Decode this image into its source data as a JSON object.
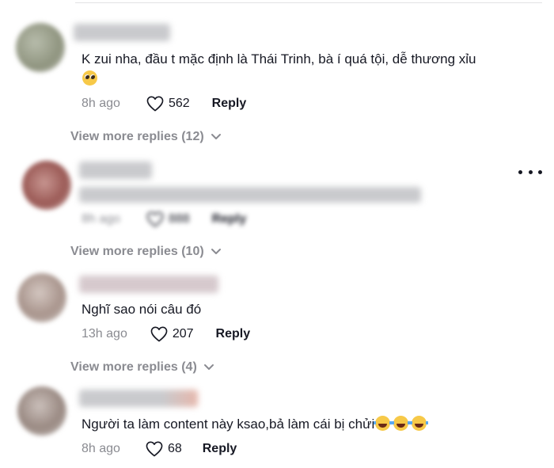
{
  "comments": [
    {
      "text": "K zui nha, đầu t mặc định là Thái Trinh, bà í quá tội, dễ thương xỉu",
      "emoji": "pleading-face",
      "time": "8h ago",
      "likes": "562",
      "reply_label": "Reply"
    },
    {
      "time": "8h ago",
      "likes": "888",
      "reply_label": "Reply",
      "more_icon": "ellipsis-icon"
    },
    {
      "text": "Nghĩ sao nói câu đó",
      "time": "13h ago",
      "likes": "207",
      "reply_label": "Reply"
    },
    {
      "text": "Người ta làm content này ksao,bả làm cái bị chửi",
      "emoji": "tears-of-joy-face",
      "time": "8h ago",
      "likes": "68",
      "reply_label": "Reply"
    }
  ],
  "view_more": [
    "View more replies (12)",
    "View more replies (10)",
    "View more replies (4)"
  ],
  "colors": {
    "text": "#161823",
    "muted": "#8a8b91",
    "divider": "#e3e3e4"
  }
}
